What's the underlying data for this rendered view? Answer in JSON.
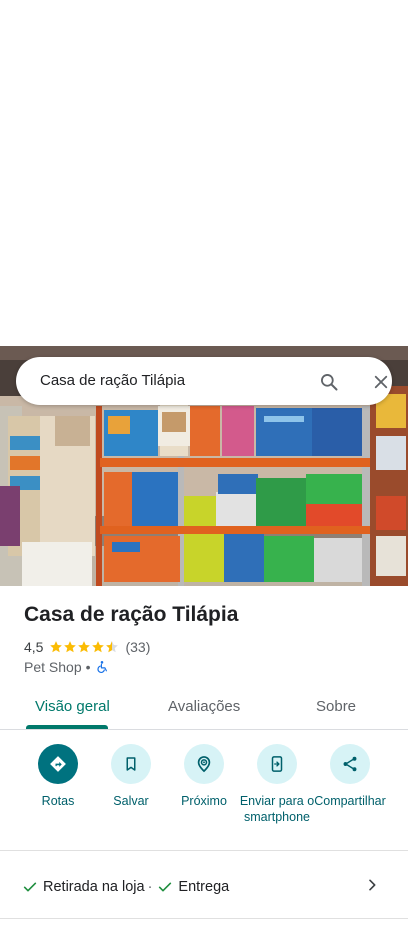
{
  "search": {
    "query": "Casa de ração Tilápia"
  },
  "place": {
    "name": "Casa de ração Tilápia",
    "rating": "4,5",
    "rating_fraction": 0.9,
    "reviews_count": "(33)",
    "category": "Pet Shop",
    "separator": "•",
    "accessibility_icon": "wheelchair-icon"
  },
  "tabs": [
    {
      "label": "Visão geral",
      "active": true
    },
    {
      "label": "Avaliações",
      "active": false
    },
    {
      "label": "Sobre",
      "active": false
    }
  ],
  "actions": [
    {
      "label": "Rotas",
      "icon": "directions-icon"
    },
    {
      "label": "Salvar",
      "icon": "bookmark-icon"
    },
    {
      "label": "Próximo",
      "icon": "nearby-icon"
    },
    {
      "label": "Enviar para o smartphone",
      "icon": "send-to-phone-icon"
    },
    {
      "label": "Compartilhar",
      "icon": "share-icon"
    }
  ],
  "services": {
    "item1": "Retirada na loja",
    "separator": "·",
    "item2": "Entrega"
  },
  "colors": {
    "accent": "#00796b",
    "primary_button": "#00727f",
    "button_tint": "#d7f3f6",
    "star": "#fbbc04",
    "check": "#1e8e3e"
  }
}
